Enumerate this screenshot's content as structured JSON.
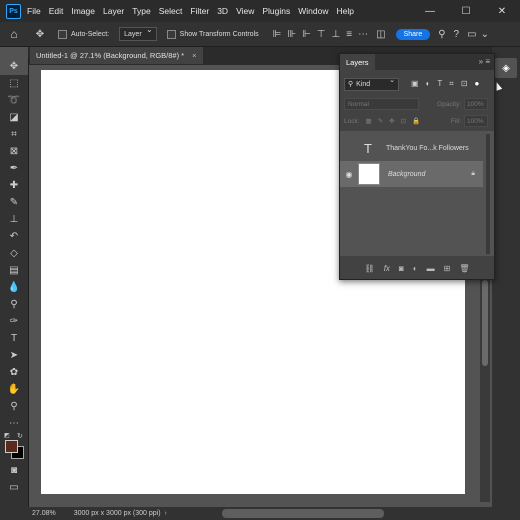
{
  "app": {
    "logo": "Ps"
  },
  "menu": [
    "File",
    "Edit",
    "Image",
    "Layer",
    "Type",
    "Select",
    "Filter",
    "3D",
    "View",
    "Plugins",
    "Window",
    "Help"
  ],
  "window_controls": {
    "minimize": "—",
    "maximize": "☐",
    "close": "✕"
  },
  "options": {
    "auto_select_label": "Auto-Select:",
    "auto_select_value": "Layer",
    "transform_label": "Show Transform Controls",
    "share_label": "Share"
  },
  "document": {
    "tab_title": "Untitled-1 @ 27.1% (Background, RGB/8#) *",
    "zoom": "27.08%",
    "info": "3000 px x 3000 px (300 ppi)"
  },
  "layers_panel": {
    "title": "Layers",
    "filter_kind": "Kind",
    "blend_mode": "Normal",
    "opacity_label": "Opacity:",
    "opacity_value": "100%",
    "lock_label": "Lock:",
    "fill_label": "Fill:",
    "fill_value": "100%",
    "layers": [
      {
        "name": "ThankYou Fo...k Followers",
        "type": "text",
        "visible": false,
        "selected": false
      },
      {
        "name": "Background",
        "type": "image",
        "visible": true,
        "selected": true,
        "locked": true
      }
    ]
  },
  "colors": {
    "foreground": "#5a2a1c",
    "background": "#000000",
    "accent": "#1473e6"
  }
}
